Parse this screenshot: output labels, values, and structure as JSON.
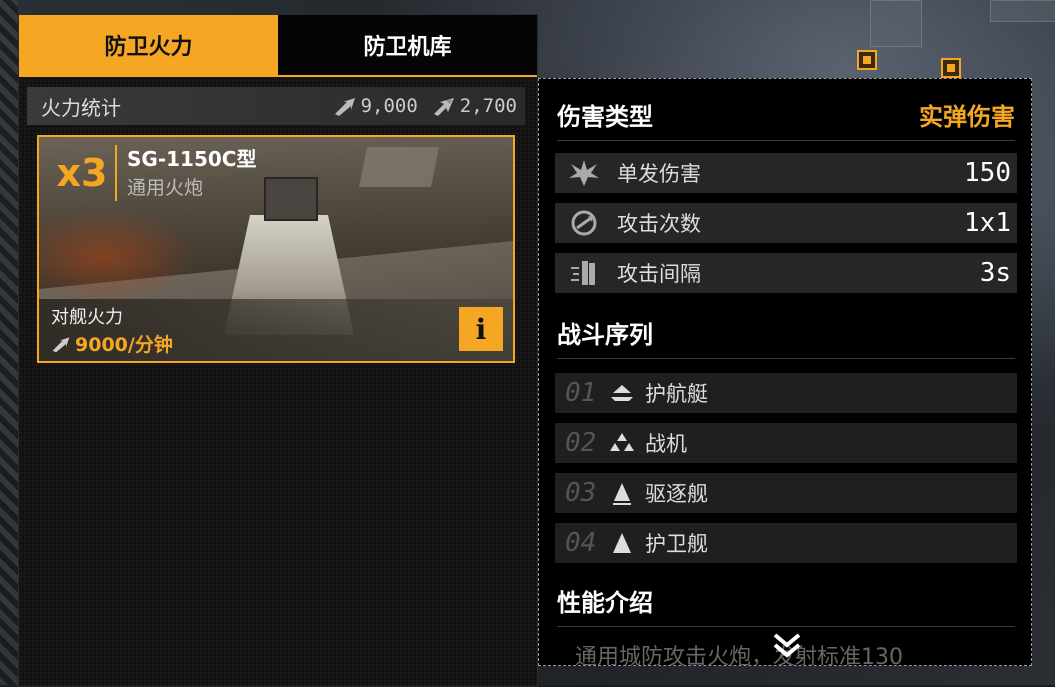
{
  "tabs": [
    {
      "label": "防卫火力",
      "active": true
    },
    {
      "label": "防卫机库",
      "active": false
    }
  ],
  "stats": {
    "label": "火力统计",
    "anti_ship": "9,000",
    "anti_air": "2,700"
  },
  "unit": {
    "count": "x3",
    "name": "SG-1150C型",
    "type": "通用火炮",
    "firepower_label": "对舰火力",
    "firepower_value": "9000/分钟",
    "info_label": "i"
  },
  "details": {
    "damage_type_label": "伤害类型",
    "damage_type_value": "实弹伤害",
    "stats": [
      {
        "icon": "burst-icon",
        "label": "单发伤害",
        "value": "150"
      },
      {
        "icon": "cycle-icon",
        "label": "攻击次数",
        "value": "1x1"
      },
      {
        "icon": "missiles-icon",
        "label": "攻击间隔",
        "value": "3s"
      }
    ],
    "sequence_label": "战斗序列",
    "sequence": [
      {
        "num": "01",
        "icon": "corvette-icon",
        "label": "护航艇"
      },
      {
        "num": "02",
        "icon": "fighter-icon",
        "label": "战机"
      },
      {
        "num": "03",
        "icon": "destroyer-icon",
        "label": "驱逐舰"
      },
      {
        "num": "04",
        "icon": "frigate-icon",
        "label": "护卫舰"
      }
    ],
    "performance_label": "性能介绍",
    "performance_text": "通用城防攻击火炮，发射标准130"
  },
  "colors": {
    "accent": "#f5a623",
    "panel": "#121212",
    "row": "#262626"
  }
}
